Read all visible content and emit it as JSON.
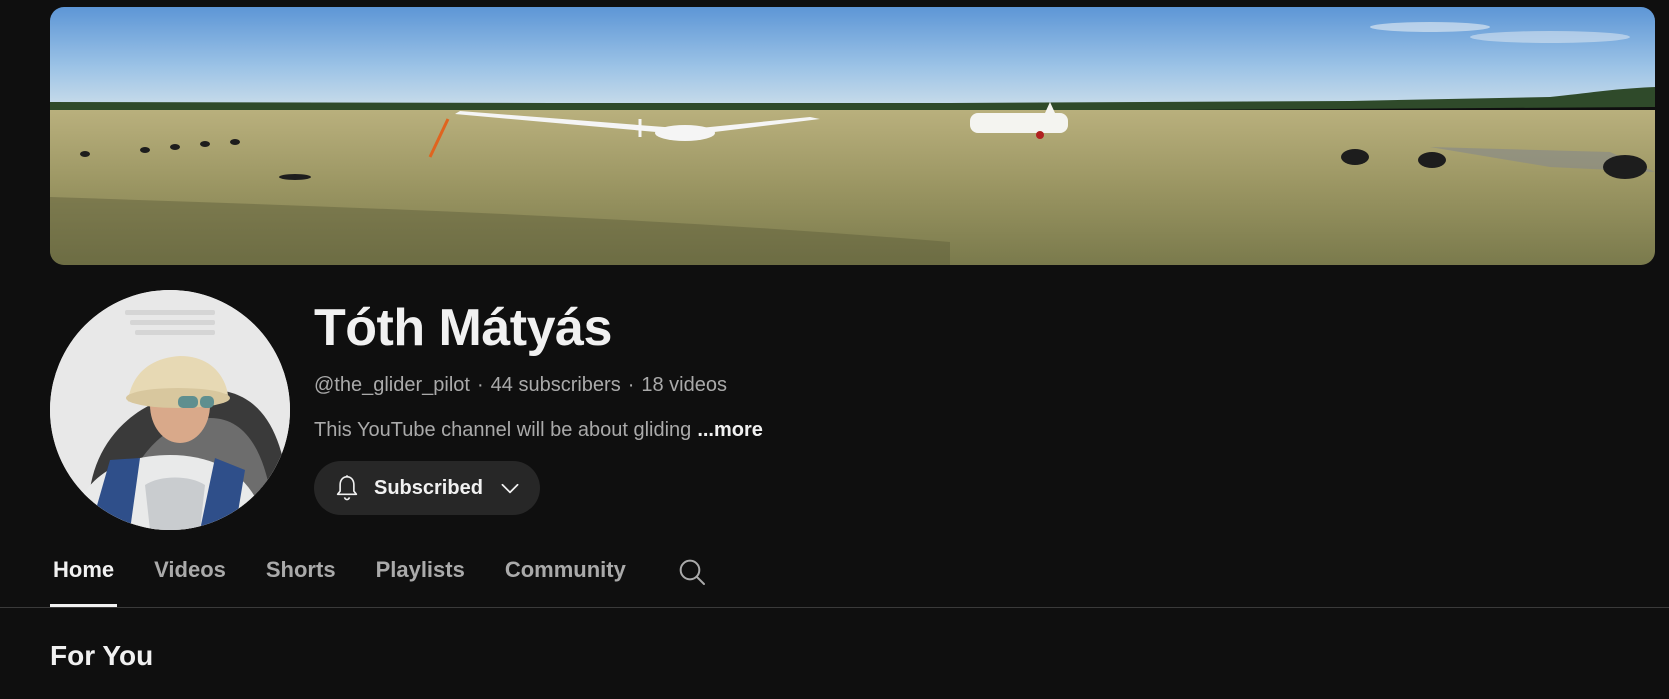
{
  "channel": {
    "name": "Tóth Mátyás",
    "handle": "@the_glider_pilot",
    "subscribers": "44 subscribers",
    "videos": "18 videos",
    "separator": "·",
    "description": "This YouTube channel will be about gliding",
    "more_label": "...more"
  },
  "subscribe": {
    "label": "Subscribed",
    "icon": "bell-icon",
    "dropdown_icon": "chevron-down-icon"
  },
  "tabs": [
    {
      "label": "Home",
      "active": true
    },
    {
      "label": "Videos",
      "active": false
    },
    {
      "label": "Shorts",
      "active": false
    },
    {
      "label": "Playlists",
      "active": false
    },
    {
      "label": "Community",
      "active": false
    }
  ],
  "search_icon": "search-icon",
  "section": {
    "title": "For You"
  },
  "colors": {
    "background": "#0f0f0f",
    "text_primary": "#f1f1f1",
    "text_secondary": "#aaaaaa",
    "button_bg": "#272727"
  }
}
